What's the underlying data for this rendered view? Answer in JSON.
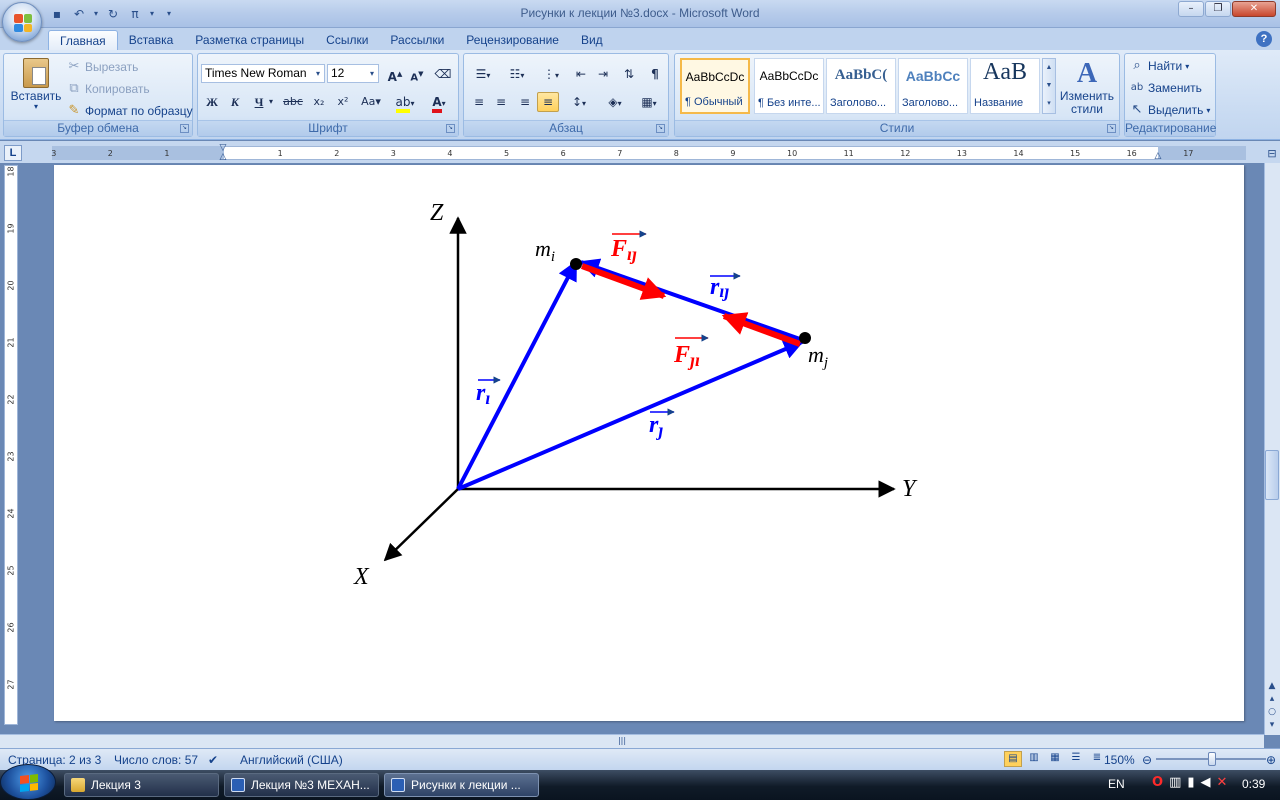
{
  "window": {
    "title": "Рисунки к лекции №3.docx - Microsoft Word"
  },
  "ribbon": {
    "tabs": [
      "Главная",
      "Вставка",
      "Разметка страницы",
      "Ссылки",
      "Рассылки",
      "Рецензирование",
      "Вид"
    ],
    "clipboard": {
      "paste": "Вставить",
      "cut": "Вырезать",
      "copy": "Копировать",
      "format_painter": "Формат по образцу",
      "label": "Буфер обмена"
    },
    "font": {
      "name": "Times New Roman",
      "size": "12",
      "label": "Шрифт"
    },
    "paragraph": {
      "label": "Абзац"
    },
    "styles": {
      "items": [
        {
          "preview": "AaBbCcDc",
          "name": "¶ Обычный"
        },
        {
          "preview": "AaBbCcDc",
          "name": "¶ Без инте..."
        },
        {
          "preview": "AaBbC(",
          "name": "Заголово..."
        },
        {
          "preview": "AaBbCc",
          "name": "Заголово..."
        },
        {
          "preview": "AaB",
          "name": "Название"
        }
      ],
      "change": "Изменить стили",
      "label": "Стили"
    },
    "editing": {
      "find": "Найти",
      "replace": "Заменить",
      "select": "Выделить",
      "label": "Редактирование"
    }
  },
  "ruler": {
    "h_ticks": [
      "3",
      "2",
      "1",
      "1",
      "2",
      "3",
      "4",
      "5",
      "6",
      "7",
      "8",
      "9",
      "10",
      "11",
      "12",
      "13",
      "14",
      "15",
      "16",
      "17"
    ],
    "v_ticks": [
      "18",
      "19",
      "20",
      "21",
      "22",
      "23",
      "24",
      "25",
      "26",
      "27"
    ]
  },
  "diagram": {
    "axis_z": "Z",
    "axis_y": "Y",
    "axis_x": "X",
    "mass_i": "m",
    "mass_i_sub": "i",
    "mass_j": "m",
    "mass_j_sub": "j",
    "force_ij": "F",
    "force_ij_sub": "ıȷ",
    "force_ji": "F",
    "force_ji_sub": "ȷı",
    "vec_rij": "r",
    "vec_rij_sub": "ıȷ",
    "vec_ri": "r",
    "vec_ri_sub": "ı",
    "vec_rj": "r",
    "vec_rj_sub": "ȷ",
    "colors": {
      "vector": "#0000ff",
      "force": "#ff0000",
      "axis": "#000000"
    }
  },
  "status": {
    "page": "Страница: 2 из 3",
    "words": "Число слов: 57",
    "language": "Английский (США)",
    "zoom": "150%"
  },
  "taskbar": {
    "items": [
      "Лекция 3",
      "Лекция №3 МЕХАН...",
      "Рисунки к лекции ..."
    ],
    "lang": "EN",
    "time": "0:39"
  }
}
